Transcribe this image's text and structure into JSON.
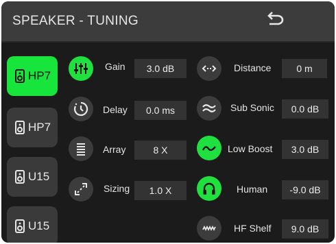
{
  "header": {
    "title": "SPEAKER - TUNING",
    "back_icon": "undo-arrow-icon"
  },
  "speakers": [
    {
      "label": "HP7",
      "icon": "speaker-icon",
      "active": true
    },
    {
      "label": "HP7",
      "icon": "speaker-icon",
      "active": false
    },
    {
      "label": "U15",
      "icon": "speaker-icon",
      "active": false
    },
    {
      "label": "U15",
      "icon": "speaker-icon",
      "active": false
    }
  ],
  "params_left": [
    {
      "label": "Gain",
      "value": "3.0 dB",
      "icon": "equalizer-sliders-icon",
      "active": true
    },
    {
      "label": "Delay",
      "value": "0.0 ms",
      "icon": "clock-icon",
      "active": false
    },
    {
      "label": "Array",
      "value": "8 X",
      "icon": "stack-lines-icon",
      "active": false
    },
    {
      "label": "Sizing",
      "value": "1.0 X",
      "icon": "resize-arrows-icon",
      "active": false
    }
  ],
  "params_right": [
    {
      "label": "Distance",
      "value": "0 m",
      "icon": "horizontal-arrows-icon",
      "active": false
    },
    {
      "label": "Sub Sonic",
      "value": "0.0 dB",
      "icon": "wave-approx-icon",
      "active": false
    },
    {
      "label": "Low Boost",
      "value": "3.0 dB",
      "icon": "low-wave-icon",
      "active": true
    },
    {
      "label": "Human",
      "value": "-9.0 dB",
      "icon": "headphones-icon",
      "active": true
    },
    {
      "label": "HF Shelf",
      "value": "9.0 dB",
      "icon": "zigzag-wave-icon",
      "active": false
    }
  ],
  "colors": {
    "accent": "#20e040",
    "panel": "#1b1b1b",
    "header": "#3c3c3c",
    "control": "#333333"
  }
}
